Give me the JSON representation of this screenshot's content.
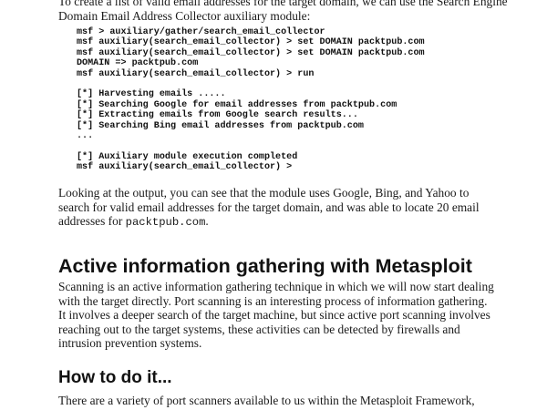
{
  "document": {
    "intro_text": "To create a list of valid email addresses for the target domain, we can use the Search Engine Domain Email Address Collector auxiliary module:",
    "code_block": {
      "lines": [
        "msf > auxiliary/gather/search_email_collector",
        "msf auxiliary(search_email_collector) > set DOMAIN packtpub.com",
        "msf auxiliary(search_email_collector) > set DOMAIN packtpub.com",
        "DOMAIN => packtpub.com",
        "msf auxiliary(search_email_collector) > run",
        "",
        "[*] Harvesting emails .....",
        "[*] Searching Google for email addresses from packtpub.com",
        "[*] Extracting emails from Google search results...",
        "[*] Searching Bing email addresses from packtpub.com",
        "...",
        "",
        "[*] Auxiliary module execution completed",
        "msf auxiliary(search_email_collector) >"
      ]
    },
    "para1_text": "Looking at the output, you can see that the module uses Google, Bing, and Yahoo to search for valid email addresses for the target domain, and was able to locate 20 email addresses for ",
    "para1_code": "packtpub.com",
    "para1_end": ".",
    "heading1": "Active information gathering with Metasploit",
    "para2_text": "Scanning is an active information gathering technique in which we will now start dealing with the target directly. Port scanning is an interesting process of information gathering. It involves a deeper search of the target machine, but since active port scanning involves reaching out to the target systems, these activities can be detected by firewalls and intrusion prevention systems.",
    "heading2": "How to do it...",
    "para3_text": "There are a variety of port scanners available to us within the Metasploit Framework, allowing us to properly enumerate the target systems. To list all the available"
  }
}
